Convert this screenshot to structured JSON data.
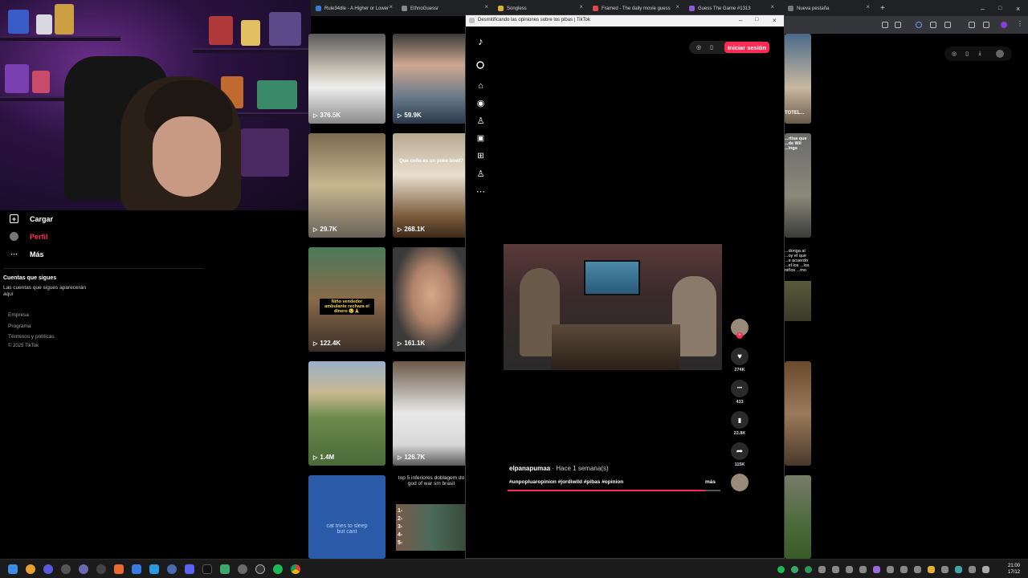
{
  "browser": {
    "tabs": [
      {
        "title": "Rule34dle - A Higher or Lower",
        "color": "#3a79d8"
      },
      {
        "title": "EthnoGuessr",
        "color": "#888888"
      },
      {
        "title": "Songless",
        "color": "#d6b23a"
      },
      {
        "title": "Framed - The daily movie guess",
        "color": "#e04848"
      },
      {
        "title": "Guess The Game #1313",
        "color": "#8a5cd8"
      },
      {
        "title": "Nueva pestaña",
        "color": "#777777"
      }
    ]
  },
  "popup": {
    "title": "Desmitificando las opiniones sobre los pibas | TikTok",
    "login_label": "Iniciar sesión",
    "author": "elpanapumaa",
    "date": "· Hace 1 semana(s)",
    "hashtags": "#unpopluaropinion #jordiwild #pibas #opinion",
    "more": "más",
    "progress": 0.93,
    "actions": [
      {
        "icon": "heart-icon",
        "glyph": "♥",
        "count": "274K"
      },
      {
        "icon": "comment-icon",
        "glyph": "•••",
        "count": "433"
      },
      {
        "icon": "bookmark-icon",
        "glyph": "▮",
        "count": "22.8K"
      },
      {
        "icon": "share-icon",
        "glyph": "➦",
        "count": "115K"
      }
    ]
  },
  "sidebar": {
    "items": [
      {
        "label": "Cargar",
        "icon": "upload-icon"
      },
      {
        "label": "Perfil",
        "icon": "profile-avatar"
      },
      {
        "label": "Más",
        "icon": "more-icon"
      }
    ],
    "following_title": "Cuentas que sigues",
    "following_text": "Las cuentas que sigues aparecerán aquí",
    "links": [
      "Empresa",
      "Programa",
      "Términos y políticas",
      "© 2025 TikTok"
    ],
    "accent": "#fe2c55"
  },
  "grid": {
    "items": [
      {
        "views": "376.5K"
      },
      {
        "views": "59.9K"
      },
      {
        "views": "29.7K"
      },
      {
        "views": "268.1K",
        "caption": "Que coño es un poke bowl?"
      },
      {
        "views": "122.4K",
        "caption": "Niño vendedor ambulante rechaza el dinero 😢🙏"
      },
      {
        "views": "161.1K"
      },
      {
        "views": "1.4M"
      },
      {
        "views": "126.7K"
      },
      {
        "caption": "cat tries to sleep but cant"
      },
      {
        "caption": "top 5 inferiores doblagem do god of war sm brasil",
        "numbers": "1-\n2-\n3-\n4-\n5-"
      }
    ],
    "right_column": [
      {
        "caption": "TOTEL..."
      },
      {
        "caption": "...rtisa que ...de Wil ...ings"
      },
      {
        "caption": "...donga al ...oy el que ...e acuerdo ...el los ...los niños ...mo"
      }
    ]
  },
  "taskbar": {
    "time": "21:00",
    "date": "17/12"
  }
}
